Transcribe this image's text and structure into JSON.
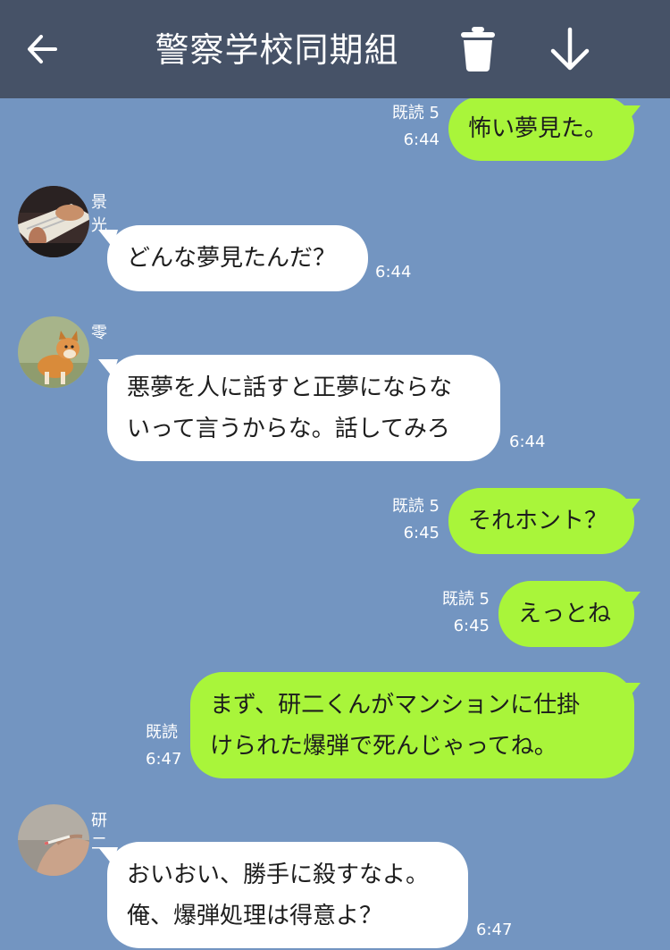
{
  "header": {
    "title": "警察学校同期組",
    "back_icon": "arrow-left-icon",
    "delete_icon": "trash-icon",
    "download_icon": "arrow-down-icon"
  },
  "messages": [
    {
      "side": "right",
      "text_lines": [
        "怖い夢見た。"
      ],
      "read": "既読 5",
      "time": "6:44"
    },
    {
      "side": "left",
      "sender": "景光",
      "text_lines": [
        "どんな夢見たんだ？"
      ],
      "time": "6:44"
    },
    {
      "side": "left",
      "sender": "零",
      "text_lines": [
        "悪夢を人に話すと正夢にならな",
        "いって言うからな。話してみろ"
      ],
      "time": "6:44"
    },
    {
      "side": "right",
      "text_lines": [
        "それホント？"
      ],
      "read": "既読 5",
      "time": "6:45"
    },
    {
      "side": "right",
      "text_lines": [
        "えっとね"
      ],
      "read": "既読 5",
      "time": "6:45"
    },
    {
      "side": "right",
      "text_lines": [
        "まず、研二くんがマンションに仕掛",
        "けられた爆弾で死んじゃってね。"
      ],
      "read": "既読",
      "time": "6:47"
    },
    {
      "side": "left",
      "sender": "研二",
      "text_lines": [
        "おいおい、勝手に殺すなよ。",
        "俺、爆弾処理は得意よ？"
      ],
      "time": "6:47"
    }
  ],
  "colors": {
    "background": "#7395c1",
    "header": "#465267",
    "own_bubble": "#a9f53a",
    "other_bubble": "#ffffff"
  }
}
